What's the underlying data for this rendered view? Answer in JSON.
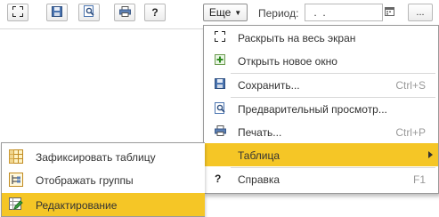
{
  "toolbar": {
    "eshe_label": "Еще",
    "period_label": "Период:",
    "period_value": " .  .",
    "dots_label": "..."
  },
  "menu": {
    "items": [
      {
        "label": "Раскрыть на весь экран",
        "shortcut": "",
        "icon": "fullscreen-icon"
      },
      {
        "label": "Открыть новое окно",
        "shortcut": "",
        "icon": "new-window-icon"
      },
      {
        "label": "Сохранить...",
        "shortcut": "Ctrl+S",
        "icon": "save-icon"
      },
      {
        "label": "Предварительный просмотр...",
        "shortcut": "",
        "icon": "preview-icon"
      },
      {
        "label": "Печать...",
        "shortcut": "Ctrl+P",
        "icon": "print-icon"
      },
      {
        "label": "Таблица",
        "shortcut": "",
        "icon": ""
      },
      {
        "label": "Справка",
        "shortcut": "F1",
        "icon": "help-icon"
      }
    ]
  },
  "submenu": {
    "items": [
      {
        "label": "Зафиксировать таблицу",
        "icon": "fix-table-icon"
      },
      {
        "label": "Отображать группы",
        "icon": "groups-icon"
      },
      {
        "label": "Редактирование",
        "icon": "edit-icon"
      }
    ]
  },
  "help_glyph": "?",
  "colors": {
    "highlight": "#f5c626",
    "border": "#9a9a9a"
  }
}
